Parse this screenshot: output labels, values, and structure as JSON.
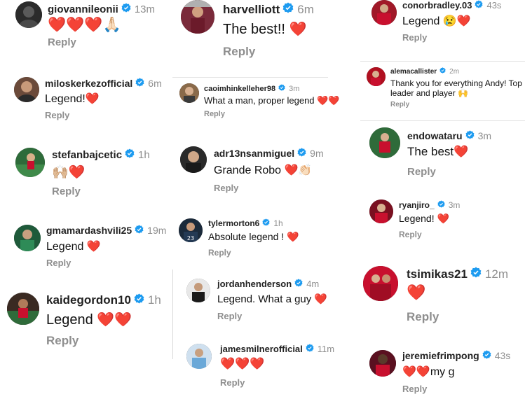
{
  "reply_label": "Reply",
  "colors": {
    "heart": "#e0141e",
    "verified": "#1d9bf0",
    "muted": "#8e8e8e"
  },
  "comments": [
    {
      "username": "giovannileonii",
      "time": "13m",
      "text": "❤️❤️❤️🙏🏻"
    },
    {
      "username": "miloskerkezofficial",
      "time": "6m",
      "text": "Legend!❤️"
    },
    {
      "username": "stefanbajcetic",
      "time": "1h",
      "text": "🙌🏼❤️"
    },
    {
      "username": "gmamardashvili25",
      "time": "19m",
      "text": "Legend ❤️"
    },
    {
      "username": "kaidegordon10",
      "time": "1h",
      "text": "Legend ❤️❤️"
    },
    {
      "username": "harvelliott",
      "time": "6m",
      "text": "The best!! ❤️"
    },
    {
      "username": "caoimhinkelleher98",
      "time": "3m",
      "text": "What a man, proper legend ❤️❤️"
    },
    {
      "username": "adr13nsanmiguel",
      "time": "9m",
      "text": "Grande Robo ❤️👏🏻"
    },
    {
      "username": "tylermorton6",
      "time": "1h",
      "text": "Absolute legend ! ❤️"
    },
    {
      "username": "jordanhenderson",
      "time": "4m",
      "text": "Legend. What a guy ❤️"
    },
    {
      "username": "jamesmilnerofficial",
      "time": "11m",
      "text": "❤️❤️❤️"
    },
    {
      "username": "conorbradley.03",
      "time": "43s",
      "text": "Legend 😢❤️"
    },
    {
      "username": "alemacallister",
      "time": "2m",
      "text": "Thank you for everything Andy! Top",
      "text2": "leader and player 🙌"
    },
    {
      "username": "endowataru",
      "time": "3m",
      "text": "The best❤️"
    },
    {
      "username": "ryanjiro_",
      "time": "3m",
      "text": "Legend! ❤️"
    },
    {
      "username": "tsimikas21",
      "time": "12m",
      "text": "❤️"
    },
    {
      "username": "jeremiefrimpong",
      "time": "43s",
      "text": "❤️❤️my g"
    }
  ]
}
